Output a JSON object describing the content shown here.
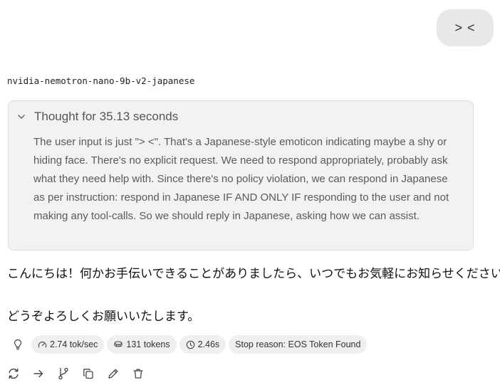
{
  "user_message": {
    "text": "> <"
  },
  "assistant": {
    "model_name": "nvidia-nemotron-nano-9b-v2-japanese",
    "thought": {
      "title": "Thought for 35.13 seconds",
      "expand_icon": "chevron-down-icon",
      "text": "The user input is just \"> <\". That's a Japanese-style emoticon indicating maybe a shy or hiding face. There's no explicit request. We need to respond appropriately, probably ask what they need help with. Since there's no policy violation, we can respond in Japanese as per instruction: respond in Japanese IF AND ONLY IF responding to the user and not making any tool-calls. So we should reply in Japanese, asking how we can assist."
    },
    "reply_lines": [
      "こんにちは！何かお手伝いできることがありましたら、いつでもお気軽にお知らせください。",
      "どうぞよろしくお願いいたします。"
    ]
  },
  "stats": {
    "icons": [
      "lightbulb-icon",
      "gauge-icon",
      "tokens-icon",
      "clock-icon"
    ],
    "speed": "2.74 tok/sec",
    "tokens": "131 tokens",
    "time": "2.46s",
    "stop_reason": "Stop reason: EOS Token Found"
  },
  "actions": [
    {
      "name": "regenerate",
      "icon": "regenerate-icon"
    },
    {
      "name": "continue",
      "icon": "arrow-right-icon"
    },
    {
      "name": "branch",
      "icon": "branch-icon"
    },
    {
      "name": "copy",
      "icon": "copy-icon"
    },
    {
      "name": "edit",
      "icon": "pencil-icon"
    },
    {
      "name": "delete",
      "icon": "trash-icon"
    }
  ],
  "colors": {
    "user_bubble_bg": "#e8e8e8",
    "thought_bg": "#f2f2f2",
    "chip_bg": "#efefef"
  }
}
